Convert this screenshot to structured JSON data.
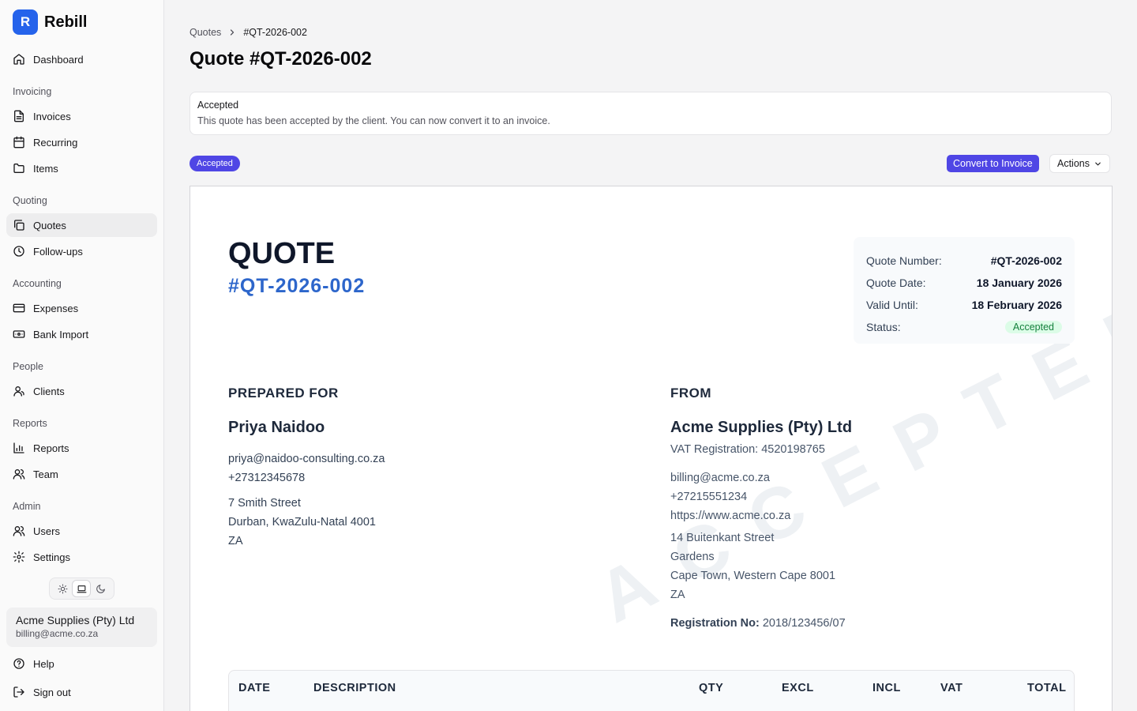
{
  "brand": {
    "logo_letter": "R",
    "name": "Rebill",
    "accent": "#2563eb"
  },
  "sidebar": {
    "dashboard": "Dashboard",
    "groups": {
      "invoicing": "Invoicing",
      "quoting": "Quoting",
      "accounting": "Accounting",
      "people": "People",
      "reports": "Reports",
      "admin": "Admin"
    },
    "items": {
      "invoices": "Invoices",
      "recurring": "Recurring",
      "items": "Items",
      "quotes": "Quotes",
      "followups": "Follow-ups",
      "expenses": "Expenses",
      "bank_import": "Bank Import",
      "clients": "Clients",
      "reports": "Reports",
      "team": "Team",
      "users": "Users",
      "settings": "Settings"
    },
    "active_item": "Quotes",
    "theme_selected": "system",
    "account": {
      "name": "Acme Supplies (Pty) Ltd",
      "email": "billing@acme.co.za"
    },
    "help": "Help",
    "sign_out": "Sign out"
  },
  "breadcrumb": {
    "parent": "Quotes",
    "current": "#QT-2026-002"
  },
  "page_title": "Quote #QT-2026-002",
  "alert": {
    "title": "Accepted",
    "description": "This quote has been accepted by the client. You can now convert it to an invoice."
  },
  "status_pill": "Accepted",
  "toolbar": {
    "convert": "Convert to Invoice",
    "actions": "Actions",
    "primary_color": "#4f46e5"
  },
  "document": {
    "title": "QUOTE",
    "number": "#QT-2026-002",
    "watermark": "ACCEPTED",
    "meta": {
      "number_label": "Quote Number:",
      "number_value": "#QT-2026-002",
      "date_label": "Quote Date:",
      "date_value": "18 January 2026",
      "valid_label": "Valid Until:",
      "valid_value": "18 February 2026",
      "status_label": "Status:",
      "status_value": "Accepted"
    },
    "prepared_for": {
      "heading": "PREPARED FOR",
      "name": "Priya Naidoo",
      "email": "priya@naidoo-consulting.co.za",
      "phone": "+27312345678",
      "address1": "7 Smith Street",
      "address2": "Durban, KwaZulu-Natal 4001",
      "country": "ZA"
    },
    "from": {
      "heading": "FROM",
      "name": "Acme Supplies (Pty) Ltd",
      "vat": "VAT Registration: 4520198765",
      "email": "billing@acme.co.za",
      "phone": "+27215551234",
      "website": "https://www.acme.co.za",
      "address1": "14 Buitenkant Street",
      "address2": "Gardens",
      "address3": "Cape Town, Western Cape 8001",
      "country": "ZA",
      "reg_label": "Registration No:",
      "reg_value": "2018/123456/07"
    },
    "table_headers": {
      "date": "DATE",
      "description": "DESCRIPTION",
      "qty": "QTY",
      "excl": "EXCL",
      "incl": "INCL",
      "vat": "VAT",
      "total": "TOTAL"
    }
  }
}
